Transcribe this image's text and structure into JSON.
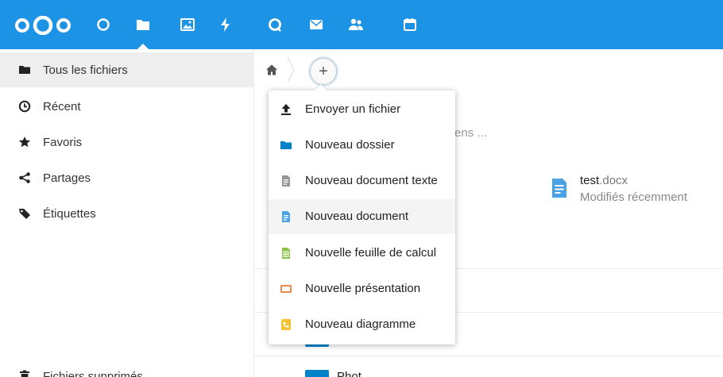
{
  "topbar": {
    "apps": [
      "dashboard-icon",
      "files-icon",
      "photos-icon",
      "activity-icon",
      "talk-icon",
      "mail-icon",
      "contacts-icon",
      "calendar-icon"
    ],
    "active_app": "files-icon",
    "color": "#1d93e6"
  },
  "sidebar": {
    "items": [
      {
        "label": "Tous les fichiers",
        "icon": "folder-icon"
      },
      {
        "label": "Récent",
        "icon": "clock-icon"
      },
      {
        "label": "Favoris",
        "icon": "star-icon"
      },
      {
        "label": "Partages",
        "icon": "share-icon"
      },
      {
        "label": "Étiquettes",
        "icon": "tag-icon"
      }
    ],
    "trash_label": "Fichiers supprimés"
  },
  "background": {
    "search_fragment": "ens ...",
    "recent_file": {
      "name": "test",
      "ext": ".docx",
      "subtitle": "Modifiés récemment"
    },
    "cut_row_text": "Phot"
  },
  "new_menu": {
    "items": [
      {
        "label": "Envoyer un fichier",
        "icon": "upload-icon",
        "color": "#222222"
      },
      {
        "label": "Nouveau dossier",
        "icon": "folder-icon",
        "color": "#0082c9"
      },
      {
        "label": "Nouveau document texte",
        "icon": "text-document-icon",
        "color": "#969696"
      },
      {
        "label": "Nouveau document",
        "icon": "document-icon",
        "color": "#49a2e4"
      },
      {
        "label": "Nouvelle feuille de calcul",
        "icon": "spreadsheet-icon",
        "color": "#8bc34a"
      },
      {
        "label": "Nouvelle présentation",
        "icon": "presentation-icon",
        "color": "#f08a50"
      },
      {
        "label": "Nouveau diagramme",
        "icon": "diagram-icon",
        "color": "#f3c236"
      }
    ],
    "hovered_index": 3
  }
}
